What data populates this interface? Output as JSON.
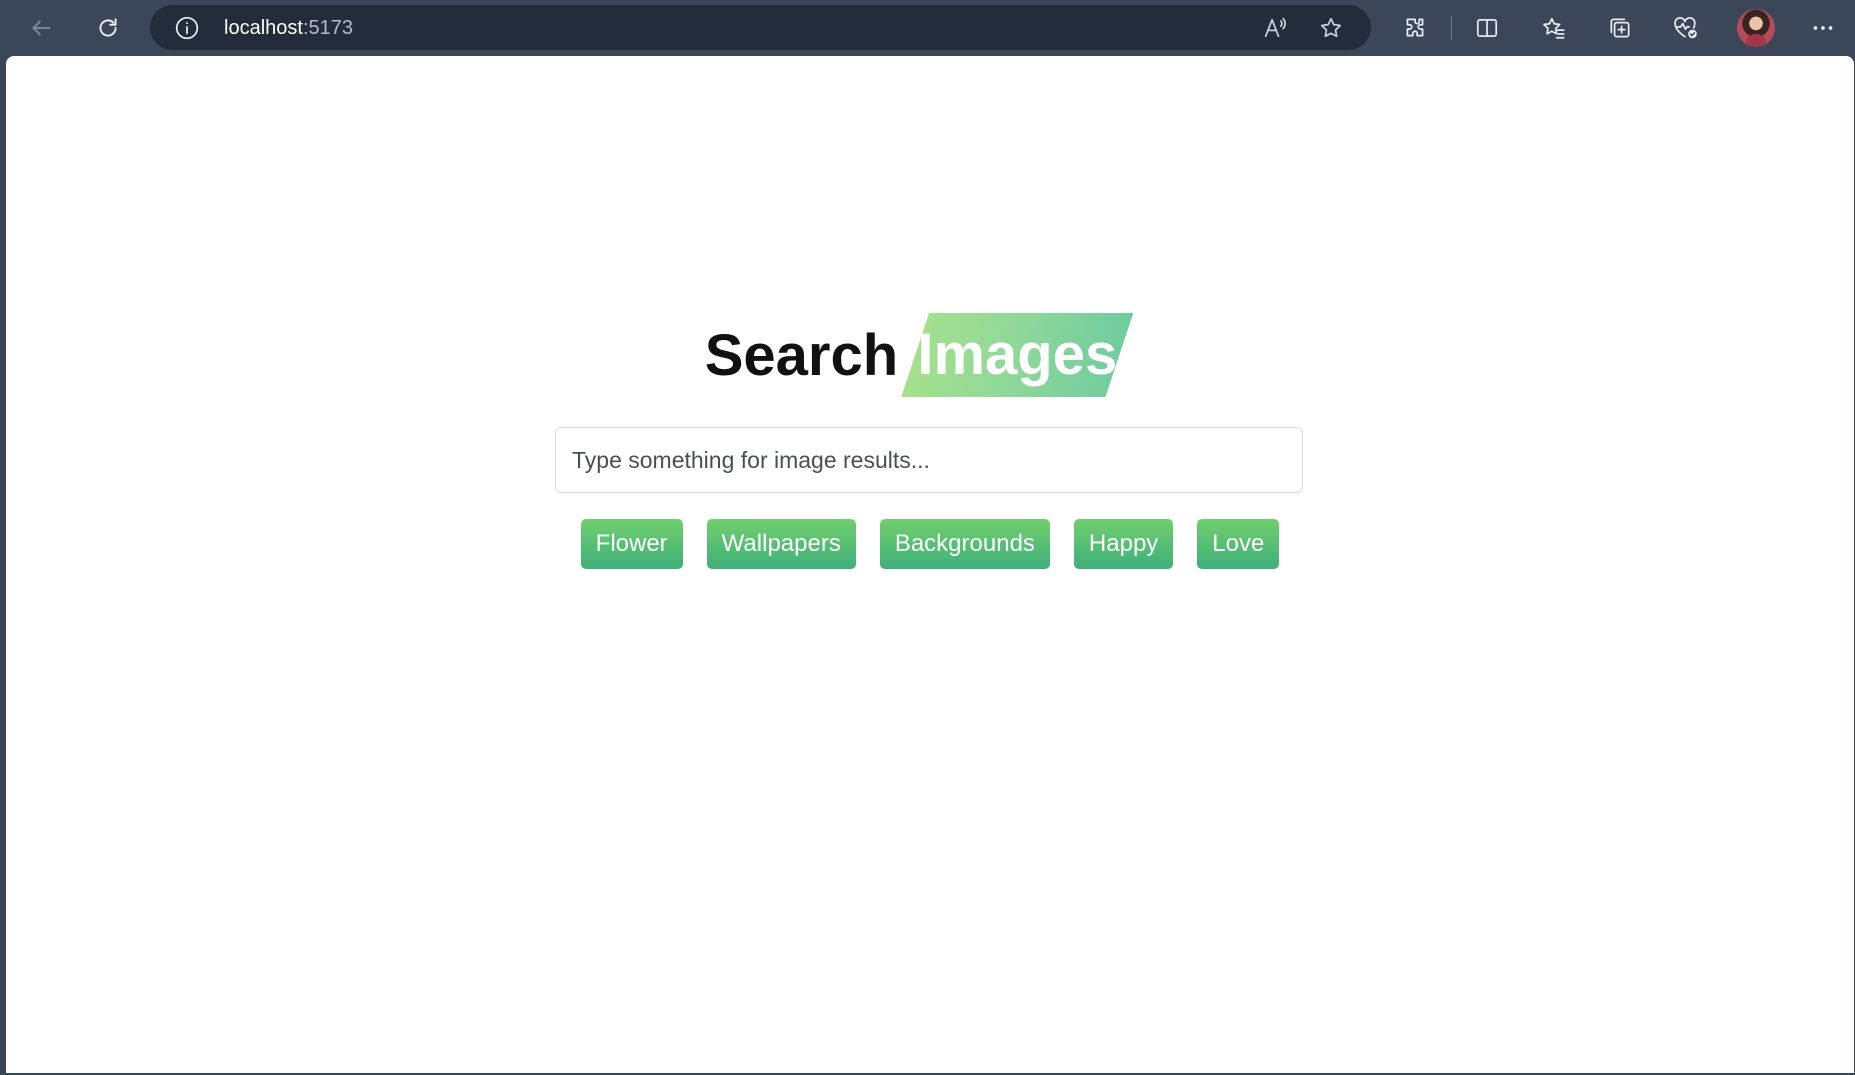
{
  "browser": {
    "url_host": "localhost",
    "url_port": ":5173",
    "toolbar_icons": [
      "back-icon",
      "refresh-icon",
      "site-info-icon",
      "read-aloud-icon",
      "favorite-star-icon",
      "extensions-icon",
      "split-screen-icon",
      "favorites-icon",
      "collections-icon",
      "browser-essentials-icon",
      "profile-avatar",
      "more-icon"
    ],
    "read_aloud_label": "A"
  },
  "page": {
    "title_part1": "Search",
    "title_part2": "Images",
    "search": {
      "placeholder": "Type something for image results...",
      "value": ""
    },
    "tags": [
      "Flower",
      "Wallpapers",
      "Backgrounds",
      "Happy",
      "Love"
    ]
  },
  "colors": {
    "browser_chrome": "#3b4658",
    "address_bar": "#232c3a",
    "tag_gradient_top": "#72cf6e",
    "tag_gradient_bottom": "#3eb07a",
    "title_highlight_start": "#a8e28a",
    "title_highlight_end": "#6bcaa1"
  }
}
